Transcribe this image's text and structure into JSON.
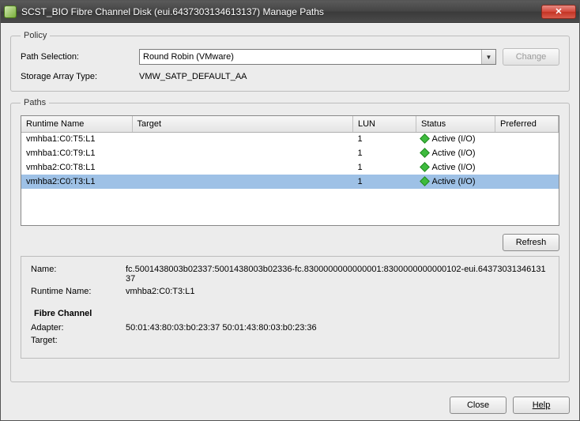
{
  "window": {
    "title": "SCST_BIO Fibre Channel Disk (eui.6437303134613137) Manage Paths"
  },
  "policy": {
    "legend": "Policy",
    "path_selection_label": "Path Selection:",
    "path_selection_value": "Round Robin (VMware)",
    "change_button": "Change",
    "storage_array_label": "Storage Array Type:",
    "storage_array_value": "VMW_SATP_DEFAULT_AA"
  },
  "paths": {
    "legend": "Paths",
    "columns": {
      "runtime": "Runtime Name",
      "target": "Target",
      "lun": "LUN",
      "status": "Status",
      "preferred": "Preferred"
    },
    "rows": [
      {
        "runtime": "vmhba1:C0:T5:L1",
        "target": "",
        "lun": "1",
        "status": "Active (I/O)",
        "preferred": "",
        "selected": false
      },
      {
        "runtime": "vmhba1:C0:T9:L1",
        "target": "",
        "lun": "1",
        "status": "Active (I/O)",
        "preferred": "",
        "selected": false
      },
      {
        "runtime": "vmhba2:C0:T8:L1",
        "target": "",
        "lun": "1",
        "status": "Active (I/O)",
        "preferred": "",
        "selected": false
      },
      {
        "runtime": "vmhba2:C0:T3:L1",
        "target": "",
        "lun": "1",
        "status": "Active (I/O)",
        "preferred": "",
        "selected": true
      }
    ],
    "refresh_button": "Refresh"
  },
  "details": {
    "name_label": "Name:",
    "name_value": "fc.5001438003b02337:5001438003b02336-fc.8300000000000001:8300000000000102-eui.6437303134613137",
    "runtime_label": "Runtime Name:",
    "runtime_value": "vmhba2:C0:T3:L1",
    "section_header": "Fibre Channel",
    "adapter_label": "Adapter:",
    "adapter_value": "50:01:43:80:03:b0:23:37 50:01:43:80:03:b0:23:36",
    "target_label": "Target:",
    "target_value": ""
  },
  "footer": {
    "close": "Close",
    "help": "Help"
  },
  "icons": {
    "close_x": "✕",
    "dropdown_arrow": "▼"
  }
}
